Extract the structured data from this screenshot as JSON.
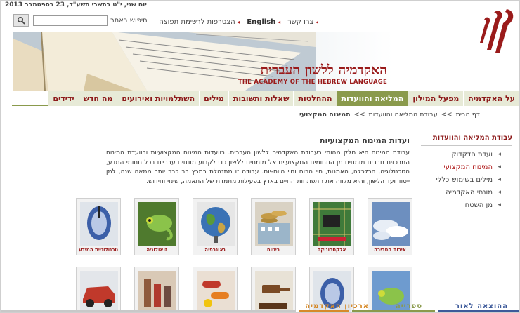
{
  "topbar": {
    "date": "יום שני, י\"ט בתשרי תשע\"ד, 23 בספטמבר 2013",
    "search_label": "חיפוש באתר",
    "search_value": "",
    "links": [
      "צרו קשר",
      "English",
      "הצטרפות לרשימת תפוצה"
    ]
  },
  "header": {
    "title_he": "האקדמיה ללשון העברית",
    "title_en": "THE ACADEMY OF THE HEBREW LANGUAGE"
  },
  "nav": {
    "tabs": [
      {
        "label": "על האקדמיה",
        "active": false
      },
      {
        "label": "מפעל המילון",
        "active": false
      },
      {
        "label": "המליאה והוועדות",
        "active": true
      },
      {
        "label": "ההחלטות",
        "active": false
      },
      {
        "label": "שאלות ותשובות",
        "active": false
      },
      {
        "label": "מילים",
        "active": false
      },
      {
        "label": "השתלמויות ואירועים",
        "active": false
      },
      {
        "label": "מה חדש",
        "active": false
      },
      {
        "label": "ידידים",
        "active": false
      }
    ]
  },
  "breadcrumb": {
    "items": [
      "דף הבית",
      ">>",
      "עבודת המליאה והוועדות",
      ">>",
      "המינוח המקצועי"
    ]
  },
  "sidebar": {
    "title": "עבודת המליאה והוועדות",
    "items": [
      {
        "label": "ועדת הדקדוק",
        "active": false
      },
      {
        "label": "המינוח המקצועי",
        "active": true
      },
      {
        "label": "מילים בשימוש כללי",
        "active": false
      },
      {
        "label": "מונחי האקדמיה",
        "active": false
      },
      {
        "label": "מן השטח",
        "active": false
      }
    ]
  },
  "content": {
    "title": "ועדות המינוח המקצועיות",
    "text": "עבודת המינוח היא חלק מהותי בעבודת האקדמיה ללשון העברית. בוועדות המינוח המקצועיות ובוועדת המינוח המרכזית חברים מומחים מן התחומים המקצועיים אל מומחים ללשון כדי לקבוע מונחים עבריים בכל תחומי המדע, הטכנולוגיה, הכלכלה, האמנות, חיי הרוח וחיי היום-יום. עבודה זו מתנהלת במרץ רב כבר יותר ממאה שנה, למן ייסוד ועד הלשון, והיא מלווה את התפתחות החיים בארץ בפעילות מתמדת של התאמה, שינוי וחידוש."
  },
  "thumbnails": [
    {
      "caption": "איכות הסביבה",
      "icon": "clouds-sky"
    },
    {
      "caption": "אלקטרוניקה",
      "icon": "circuit-board"
    },
    {
      "caption": "ביטוח",
      "icon": "coins-calculator"
    },
    {
      "caption": "גאוגרפיה",
      "icon": "globe"
    },
    {
      "caption": "זואולוגיה",
      "icon": "chameleon"
    },
    {
      "caption": "טכנולוגיית המידע",
      "icon": "computer-mouse"
    },
    {
      "caption": "",
      "icon": "chameleon"
    },
    {
      "caption": "",
      "icon": "computer-mouse"
    },
    {
      "caption": "",
      "icon": "gavel"
    },
    {
      "caption": "",
      "icon": "pills"
    },
    {
      "caption": "",
      "icon": "cosmetics"
    },
    {
      "caption": "",
      "icon": "car"
    }
  ],
  "footer": [
    {
      "label": "ההוצאה לאור",
      "color": "#3d5a9a"
    },
    {
      "label": "ספרייה",
      "color": "#8a9a4c"
    },
    {
      "label": "ארכיון האקדמיה",
      "color": "#d68a2a"
    }
  ],
  "colors": {
    "brand": "#9a1b1b",
    "nav_active": "#8a9a4c",
    "nav_bg": "#e7ead7"
  }
}
